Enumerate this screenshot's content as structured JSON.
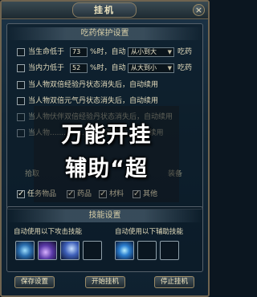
{
  "window": {
    "title": "挂机",
    "close_glyph": "×"
  },
  "drug_section": {
    "heading": "吃药保护设置",
    "rows": [
      {
        "label": "当生命低于",
        "value": "73",
        "unit": "%时，自动",
        "option": "从小到大",
        "action": "吃药",
        "checked": false
      },
      {
        "label": "当内力低于",
        "value": "52",
        "unit": "%时，自动",
        "option": "从大到小",
        "action": "吃药",
        "checked": false
      }
    ],
    "options": [
      {
        "label": "当人物双倍经验丹状态消失后，自动续用",
        "checked": false
      },
      {
        "label": "当人物双倍元气丹状态消失后，自动续用",
        "checked": false
      },
      {
        "label": "当人物伏伴双倍经验丹状态消失后，自动续用",
        "checked": false
      },
      {
        "label": "当人物..................状态消失后，自动续用",
        "checked": false
      }
    ]
  },
  "pickup": {
    "left_label": "拾取",
    "right_label": "装备",
    "items": [
      {
        "label": "任务物品",
        "checked": true
      },
      {
        "label": "药品",
        "checked": true
      },
      {
        "label": "材料",
        "checked": true
      },
      {
        "label": "其他",
        "checked": true
      }
    ]
  },
  "skill_section": {
    "heading": "技能设置",
    "attack_label": "自动使用以下攻击技能",
    "assist_label": "自动使用以下辅助技能"
  },
  "buttons": {
    "save": "保存设置",
    "start": "开始挂机",
    "stop": "停止挂机"
  },
  "overlay": {
    "line1": "万能开挂",
    "line2": "辅助“超"
  }
}
